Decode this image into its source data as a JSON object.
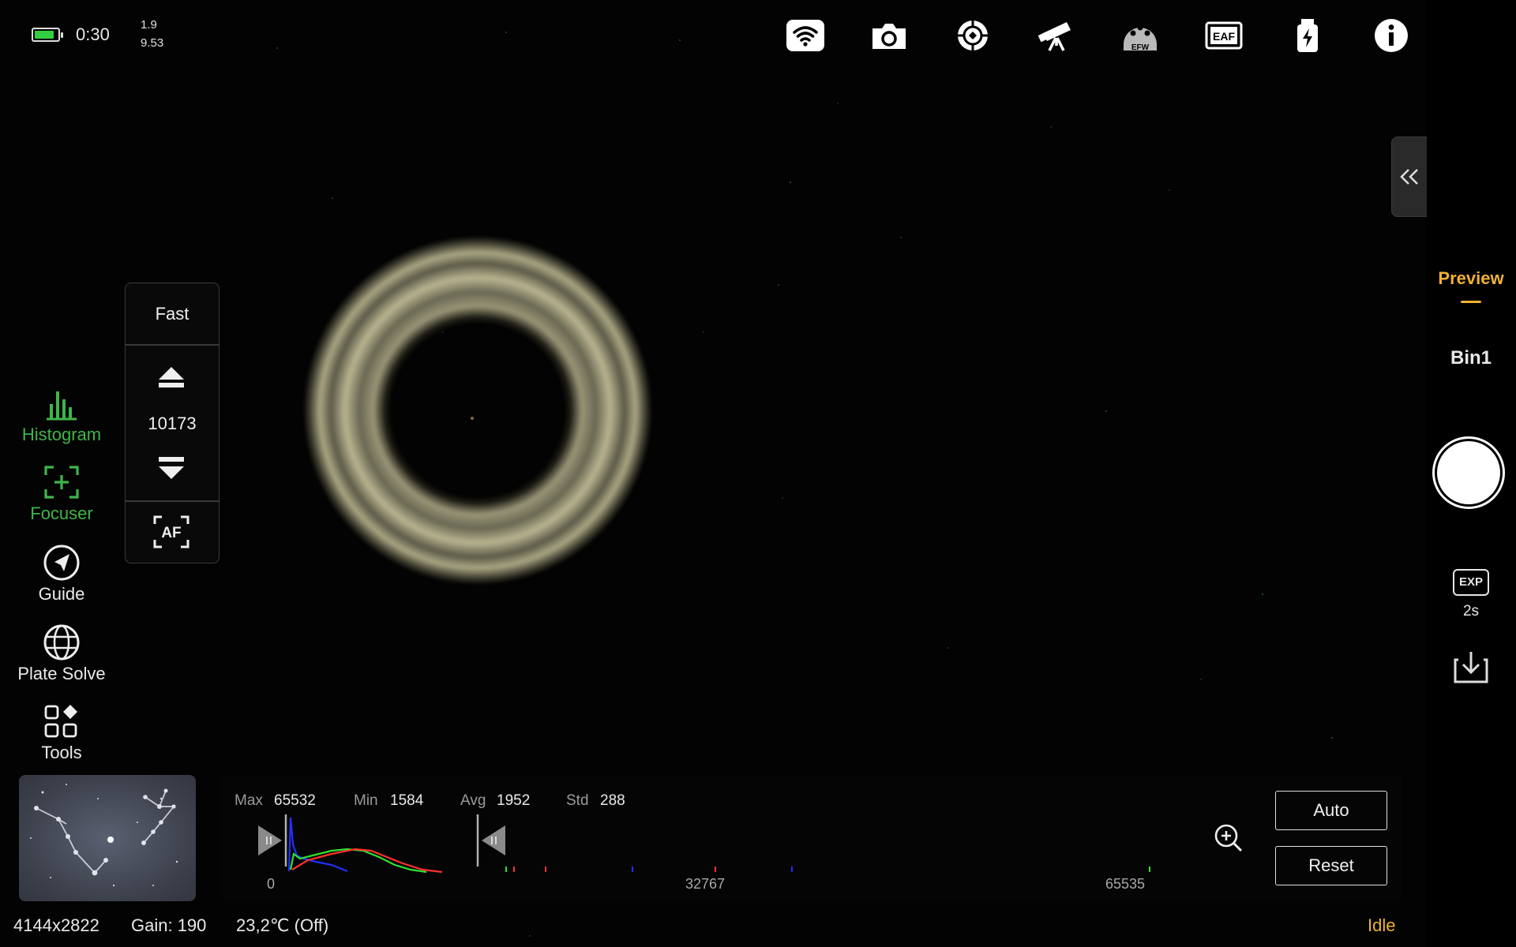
{
  "status_bar": {
    "battery_level": 0.85,
    "battery_color": "#32d040",
    "clock": "0:30",
    "value_top": "1.9",
    "value_bottom": "9.53"
  },
  "top_icons": [
    {
      "name": "wifi-icon"
    },
    {
      "name": "camera-icon"
    },
    {
      "name": "guide-target-icon"
    },
    {
      "name": "telescope-icon"
    },
    {
      "name": "efw-icon",
      "text": "EFW"
    },
    {
      "name": "eaf-icon",
      "text": "EAF"
    },
    {
      "name": "usb-power-icon"
    },
    {
      "name": "info-icon"
    }
  ],
  "left_menu": [
    {
      "label": "Histogram",
      "icon": "histogram-icon",
      "active": true
    },
    {
      "label": "Focuser",
      "icon": "focuser-icon",
      "active": true
    },
    {
      "label": "Guide",
      "icon": "guide-icon",
      "active": false
    },
    {
      "label": "Plate Solve",
      "icon": "globe-icon",
      "active": false
    },
    {
      "label": "Tools",
      "icon": "tools-icon",
      "active": false
    }
  ],
  "focuser": {
    "speed": "Fast",
    "position": "10173",
    "af_label": "AF"
  },
  "right_panel": {
    "mode": "Preview",
    "bin": "Bin1",
    "exp_icon_text": "EXP",
    "exposure": "2s",
    "accent_color": "#f0b232"
  },
  "histogram": {
    "stats": [
      {
        "label": "Max",
        "value": "65532"
      },
      {
        "label": "Min",
        "value": "1584"
      },
      {
        "label": "Avg",
        "value": "1952"
      },
      {
        "label": "Std",
        "value": "288"
      }
    ],
    "axis": [
      "0",
      "32767",
      "65535"
    ],
    "buttons": {
      "auto": "Auto",
      "reset": "Reset"
    },
    "series_colors": {
      "blue": "#2030ff",
      "green": "#30e030",
      "red": "#ff3030"
    }
  },
  "bottom_status": {
    "resolution": "4144x2822",
    "gain": "Gain: 190",
    "temperature": "23,2℃  (Off)",
    "state": "Idle"
  }
}
